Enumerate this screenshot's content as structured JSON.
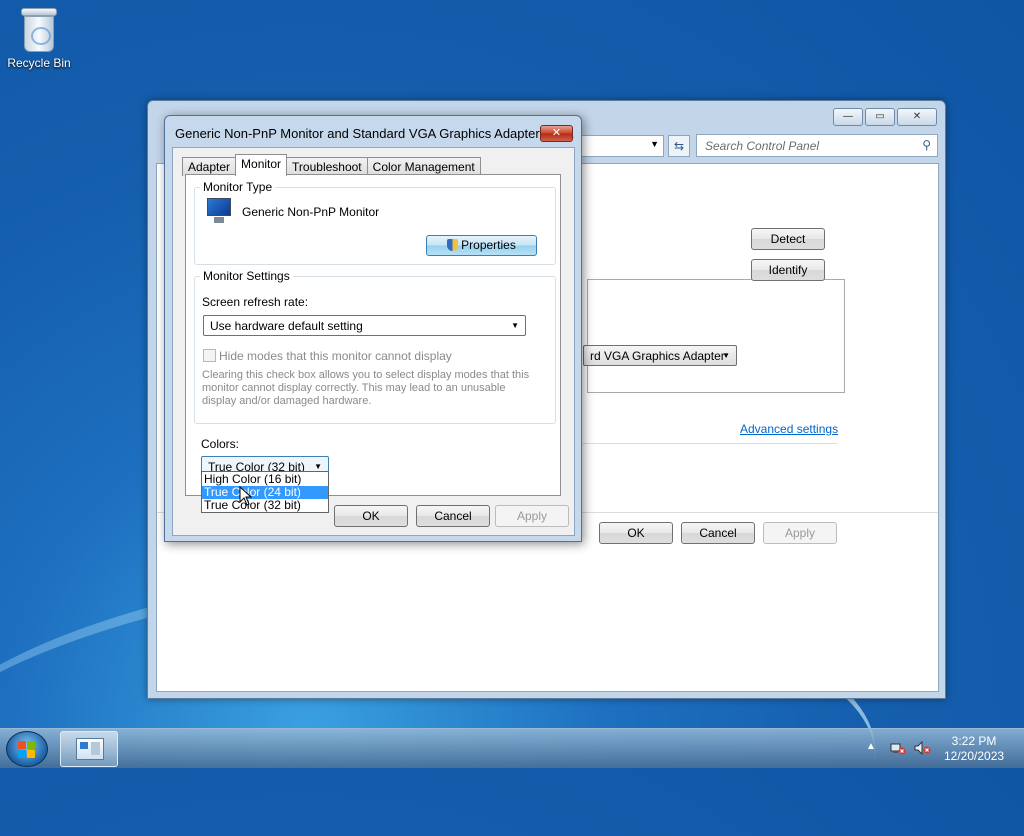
{
  "desktop": {
    "recycle_bin_label": "Recycle Bin"
  },
  "control_panel": {
    "search_placeholder": "Search Control Panel",
    "detect_label": "Detect",
    "identify_label": "Identify",
    "adapter_select": "rd VGA Graphics Adapter",
    "advanced_settings_link": "Advanced settings",
    "ok_label": "OK",
    "cancel_label": "Cancel",
    "apply_label": "Apply",
    "window_controls": {
      "minimize": "—",
      "maximize": "▭",
      "close": "✕"
    }
  },
  "dialog": {
    "title": "Generic Non-PnP Monitor and Standard VGA Graphics Adapter Pro...",
    "tabs": [
      {
        "label": "Adapter"
      },
      {
        "label": "Monitor"
      },
      {
        "label": "Troubleshoot"
      },
      {
        "label": "Color Management"
      }
    ],
    "active_tab": "Monitor",
    "monitor_type": {
      "group_title": "Monitor Type",
      "monitor_name": "Generic Non-PnP Monitor",
      "properties_label": "Properties"
    },
    "monitor_settings": {
      "group_title": "Monitor Settings",
      "refresh_rate_label": "Screen refresh rate:",
      "refresh_rate_value": "Use hardware default setting",
      "hide_modes_label": "Hide modes that this monitor cannot display",
      "hide_modes_checked": false,
      "warning_line1": "Clearing this check box allows you to select display modes that this",
      "warning_line2": "monitor cannot display correctly. This may lead to an unusable",
      "warning_line3": "display and/or damaged hardware."
    },
    "colors": {
      "label": "Colors:",
      "selected_value": "True Color (32 bit)",
      "options": [
        "High Color (16 bit)",
        "True Color (24 bit)",
        "True Color (32 bit)"
      ],
      "highlighted_option": "True Color (24 bit)"
    },
    "ok_label": "OK",
    "cancel_label": "Cancel",
    "apply_label": "Apply"
  },
  "taskbar": {
    "time": "3:22 PM",
    "date": "12/20/2023",
    "tray_arrow": "▲"
  },
  "colors": {
    "desktop_blue": "#155fae",
    "selection": "#3399ff",
    "link": "#0066cc",
    "close_red": "#c7422b"
  }
}
